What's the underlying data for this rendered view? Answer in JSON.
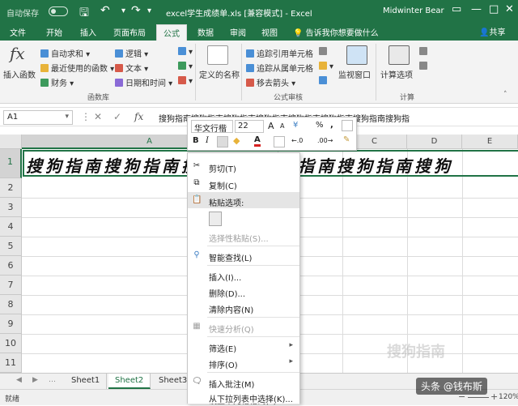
{
  "titlebar": {
    "autosave_label": "自动保存",
    "document_title": "excel学生成绩单.xls [兼容模式] - Excel",
    "user_name": "Midwinter Bear"
  },
  "tabs": [
    "文件",
    "开始",
    "插入",
    "页面布局",
    "公式",
    "数据",
    "审阅",
    "视图"
  ],
  "active_tab": "公式",
  "tell_me": "告诉我你想要做什么",
  "share_label": "共享",
  "ribbon": {
    "insert_function": "插入函数",
    "library": {
      "autosum": "自动求和",
      "recent": "最近使用的函数",
      "financial": "财务",
      "logical": "逻辑",
      "text": "文本",
      "datetime": "日期和时间",
      "group_label": "函数库"
    },
    "defined_names": "定义的名称",
    "audit": {
      "trace_precedents": "追踪引用单元格",
      "trace_dependents": "追踪从属单元格",
      "remove_arrows": "移去箭头",
      "group_label": "公式审核"
    },
    "watch_window": "监视窗口",
    "calc_options": "计算选项",
    "calc_group_label": "计算"
  },
  "formula_bar": {
    "name_box": "A1",
    "formula": "搜狗指南搜狗指南搜狗指南搜狗指南搜狗指南搜狗指南搜狗指南搜狗指"
  },
  "grid": {
    "columns": [
      "A",
      "B",
      "C",
      "D",
      "E"
    ],
    "rows": [
      "1",
      "2",
      "3",
      "4",
      "5",
      "6",
      "7",
      "8",
      "9",
      "10",
      "11"
    ],
    "cell_a1": "搜狗指南搜狗指南搜狗指南搜狗指南搜狗指南搜狗"
  },
  "mini_toolbar": {
    "font": "华文行楷",
    "size": "22",
    "grow": "A",
    "shrink": "A",
    "currency": "¥",
    "percent": "%",
    "comma": ",",
    "bold": "B",
    "italic": "I",
    "font_color": "A",
    "inc_decimal": "←.0",
    "dec_decimal": ".00→"
  },
  "context_menu": {
    "cut": "剪切(T)",
    "copy": "复制(C)",
    "paste_options": "粘贴选项:",
    "paste_special": "选择性粘贴(S)...",
    "smart_lookup": "智能查找(L)",
    "insert": "插入(I)...",
    "delete": "删除(D)...",
    "clear": "清除内容(N)",
    "quick_analysis": "快速分析(Q)",
    "filter": "筛选(E)",
    "sort": "排序(O)",
    "insert_comment": "插入批注(M)",
    "format_cells": "设置单元格格式(F)...",
    "pick_list": "从下拉列表中选择(K)..."
  },
  "sheets": [
    "Sheet1",
    "Sheet2",
    "Sheet3"
  ],
  "active_sheet": "Sheet2",
  "status": {
    "ready": "就绪",
    "zoom": "120%"
  },
  "watermarks": {
    "grid_logo": "搜狗指南",
    "corner": "头条 @钱布斯"
  },
  "colors": {
    "excel_green": "#217346"
  }
}
